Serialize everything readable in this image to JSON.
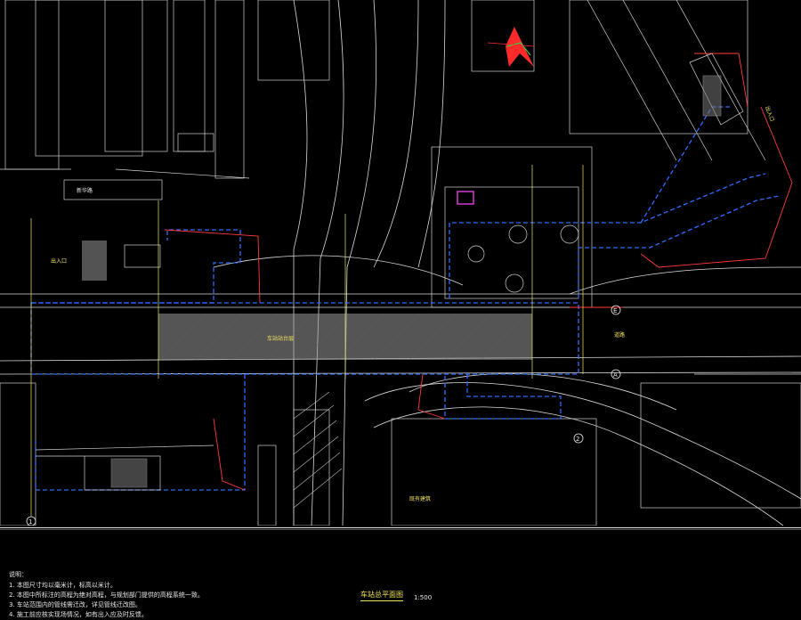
{
  "drawing": {
    "label_color": "#f2e45a",
    "outline_color": "#2f6bff",
    "boundary_color": "#ff3b3b",
    "linework_color": "#d9d9d9",
    "platform_fill_color": "#9a9a9a",
    "axis_markers": [
      "1",
      "E",
      "A",
      "2"
    ],
    "labels": {
      "street_north": "新华路",
      "station_hall": "车站站台层",
      "entrance_east": "出入口",
      "road_east": "道路",
      "entrance_west": "出入口",
      "building_south": "既有建筑"
    },
    "icons": [
      "north-arrow-icon",
      "axis-marker-icon"
    ]
  },
  "notes": {
    "title": "说明：",
    "items": [
      "1. 本图尺寸均以毫米计，标高以米计。",
      "2. 本图中所标注的高程为绝对高程，与规划部门提供的高程系统一致。",
      "3. 车站范围内的管线需迁改，详见管线迁改图。",
      "4. 施工前应核实现场情况，如有出入应及时反馈。"
    ]
  },
  "plan": {
    "title": "车站总平面图",
    "scale": "1:500"
  }
}
